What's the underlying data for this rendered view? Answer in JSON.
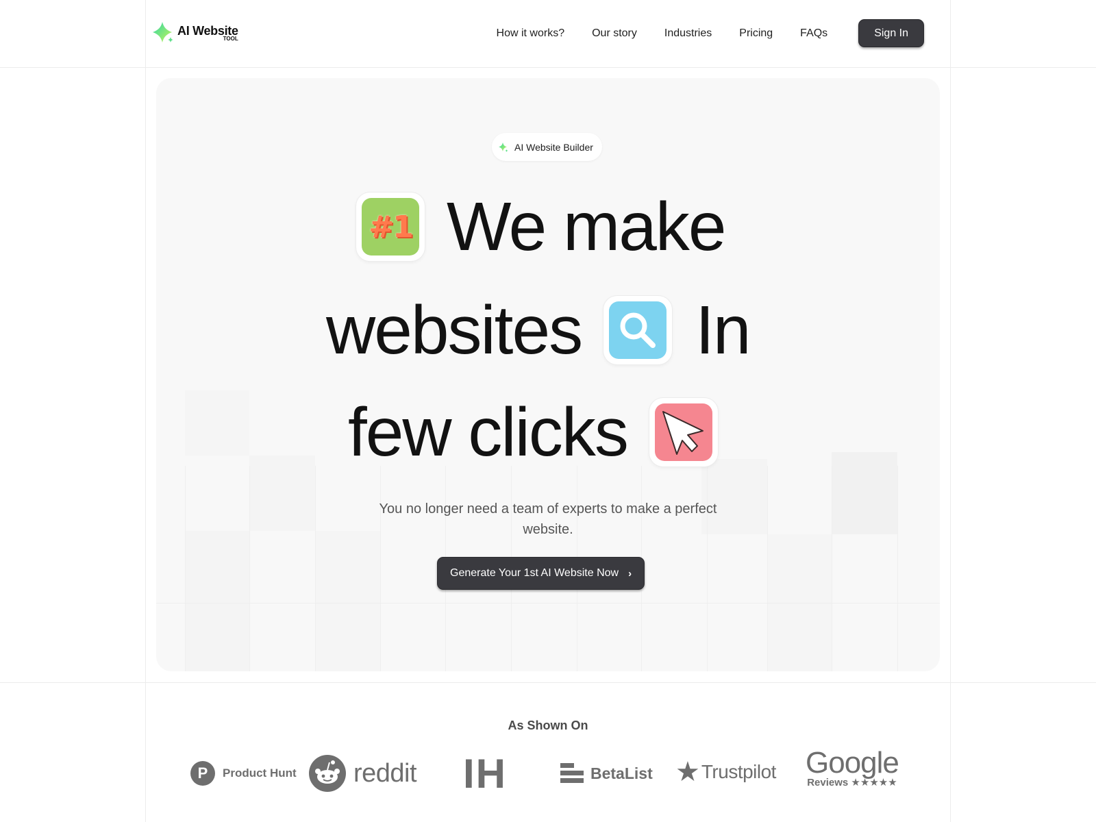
{
  "header": {
    "logo": {
      "main": "AI Website",
      "sub": "TOOL",
      "icon": "sparkle-gradient-icon"
    },
    "nav": [
      {
        "label": "How it works?"
      },
      {
        "label": "Our story"
      },
      {
        "label": "Industries"
      },
      {
        "label": "Pricing"
      },
      {
        "label": "FAQs"
      }
    ],
    "signin_label": "Sign In"
  },
  "hero": {
    "badge_label": "AI Website Builder",
    "headline": {
      "line1": "We make",
      "line2_a": "websites",
      "line2_b": "In",
      "line3": "few clicks"
    },
    "emojis": [
      {
        "name": "number-one-icon",
        "text": "#1",
        "bg": "#9ed163",
        "fg": "#ff7a4d"
      },
      {
        "name": "magnifier-icon",
        "bg": "#7dd3f0"
      },
      {
        "name": "cursor-arrow-icon",
        "bg": "#f58690"
      }
    ],
    "subtitle": "You no longer need a team of experts to make a perfect website.",
    "cta_label": "Generate Your 1st AI Website Now",
    "cta_chevron": "›"
  },
  "shown_on": {
    "title": "As Shown On",
    "logos": [
      {
        "name": "Product Hunt",
        "mark": "P"
      },
      {
        "name": "reddit"
      },
      {
        "name": "IH"
      },
      {
        "name": "BetaList"
      },
      {
        "name": "Trustpilot",
        "mark": "★"
      },
      {
        "name": "Google",
        "sub": "Reviews ★★★★★"
      }
    ]
  },
  "colors": {
    "dark_button": "#3a3a3f",
    "hero_bg": "#f8f8f8",
    "logo_grey": "#6e6e6e"
  }
}
